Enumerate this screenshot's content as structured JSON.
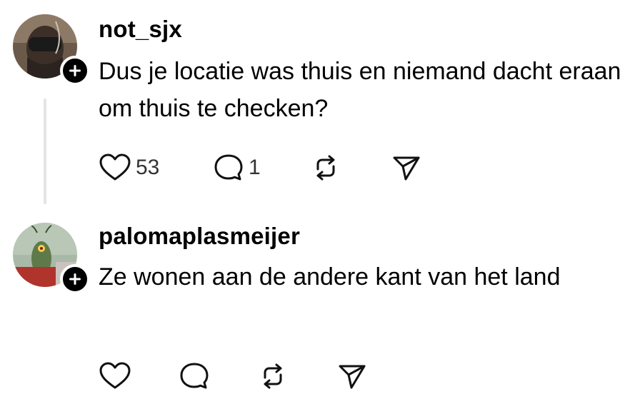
{
  "comments": [
    {
      "username": "not_sjx",
      "text": "Dus je locatie was thuis en niemand dacht eraan om thuis te checken?",
      "avatar_icon": "avatar-photo",
      "follow_icon": "plus-icon",
      "like_count": "53",
      "reply_count": "1",
      "icons": [
        "heart-icon",
        "comment-icon",
        "repost-icon",
        "send-icon"
      ]
    },
    {
      "username": "palomaplasmeijer",
      "text": "Ze wonen aan de andere kant van het land",
      "avatar_icon": "avatar-cartoon",
      "follow_icon": "plus-icon",
      "like_count": "",
      "reply_count": "",
      "icons": [
        "heart-icon",
        "comment-icon",
        "repost-icon",
        "send-icon"
      ]
    }
  ],
  "colors": {
    "text": "#000000",
    "count": "#333333",
    "thread_line": "#e4e4e4",
    "badge": "#000000"
  }
}
